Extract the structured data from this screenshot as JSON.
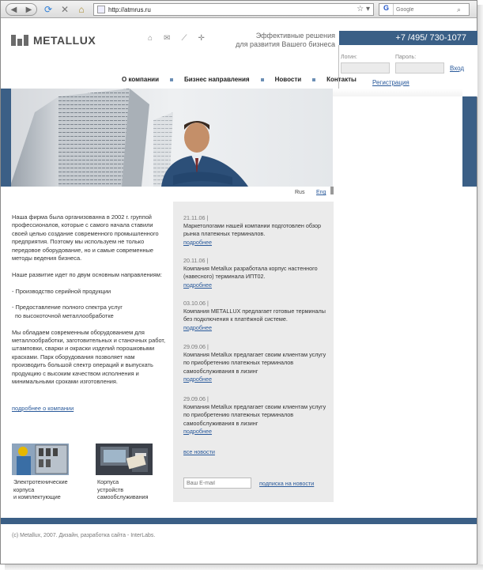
{
  "browser": {
    "url": "http://atmrus.ru",
    "search_placeholder": "Google",
    "search_engine": "G"
  },
  "brand": {
    "name": "METALLUX",
    "accent": "#3b5f86",
    "link": "#2a5a9b"
  },
  "header": {
    "tagline_1": "Эффективные решения",
    "tagline_2": "для развития Вашего бизнеса",
    "phone": "+7 /495/ 730-1077",
    "icons": [
      "home-icon",
      "mail-icon",
      "sitemap-icon",
      "search-icon"
    ]
  },
  "login": {
    "login_label": "Логин:",
    "password_label": "Пароль:",
    "submit": "Вход",
    "register": "Регистрация"
  },
  "menu": {
    "items": [
      "О компании",
      "Бизнес направления",
      "Новости",
      "Контакты"
    ]
  },
  "lang": {
    "ru": "Rus",
    "en": "Eng"
  },
  "intro": {
    "p1": "Наша фирма была организованна в 2002 г. группой профессионалов, которые с самого начала ставили своей целью создание современного промышленного предприятия. Поэтому мы используем не только передовое оборудование, но и самые современные методы ведения бизнеса.",
    "p2": "Наше развитие идет по двум основным направлениям:",
    "p3": "- Производство серийной продукции",
    "p4a": "- Предоставление полного спектра услуг",
    "p4b": "по высокоточной металлообработке",
    "p5": "Мы обладаем современным оборудованием для металлообработки, заготовительных и станочных работ, штамповки, сварки и окраски изделий порошковыми красками. Парк оборудования позволяет нам производить большой спектр операций и выпускать продукцию с высоким качеством исполнения и минимальными сроками изготовления.",
    "more": "подробнее о компании"
  },
  "news": {
    "items": [
      {
        "date": "21.11.06 |",
        "text": "Маркетологами нашей компании подготовлен обзор рынка платежных терминалов.",
        "more": "подробнее"
      },
      {
        "date": "20.11.06 |",
        "text": "Компания Metallux разработала корпус настенного (навесного) терминала ИПТ02.",
        "more": "подробнее"
      },
      {
        "date": "03.10.06 |",
        "text": "Компания METALLUX предлагает готовые терминалы без подключения к платёжной системе.",
        "more": "подробнее"
      },
      {
        "date": "29.09.06 |",
        "text": "Компания Metallux предлагает своим клиентам услугу по приобретению платежных терминалов самообслуживания в лизинг",
        "more": "подробнее"
      },
      {
        "date": "29.09.06 |",
        "text": "Компания Metallux предлагает своим клиентам услугу по приобретению платежных терминалов самообслуживания в лизинг",
        "more": "подробнее"
      }
    ],
    "all": "все новости",
    "email_placeholder": "Ваш E-mail",
    "subscribe": "подписка на новости"
  },
  "products": [
    {
      "line1": "Электротехнические",
      "line2": "корпуса",
      "line3": "и комплектующие"
    },
    {
      "line1": "Корпуса",
      "line2": "устройств",
      "line3": "самообслуживания"
    }
  ],
  "footer": {
    "text": "(c) Metallux, 2007. Дизайн, разработка сайта - InterLabs."
  }
}
